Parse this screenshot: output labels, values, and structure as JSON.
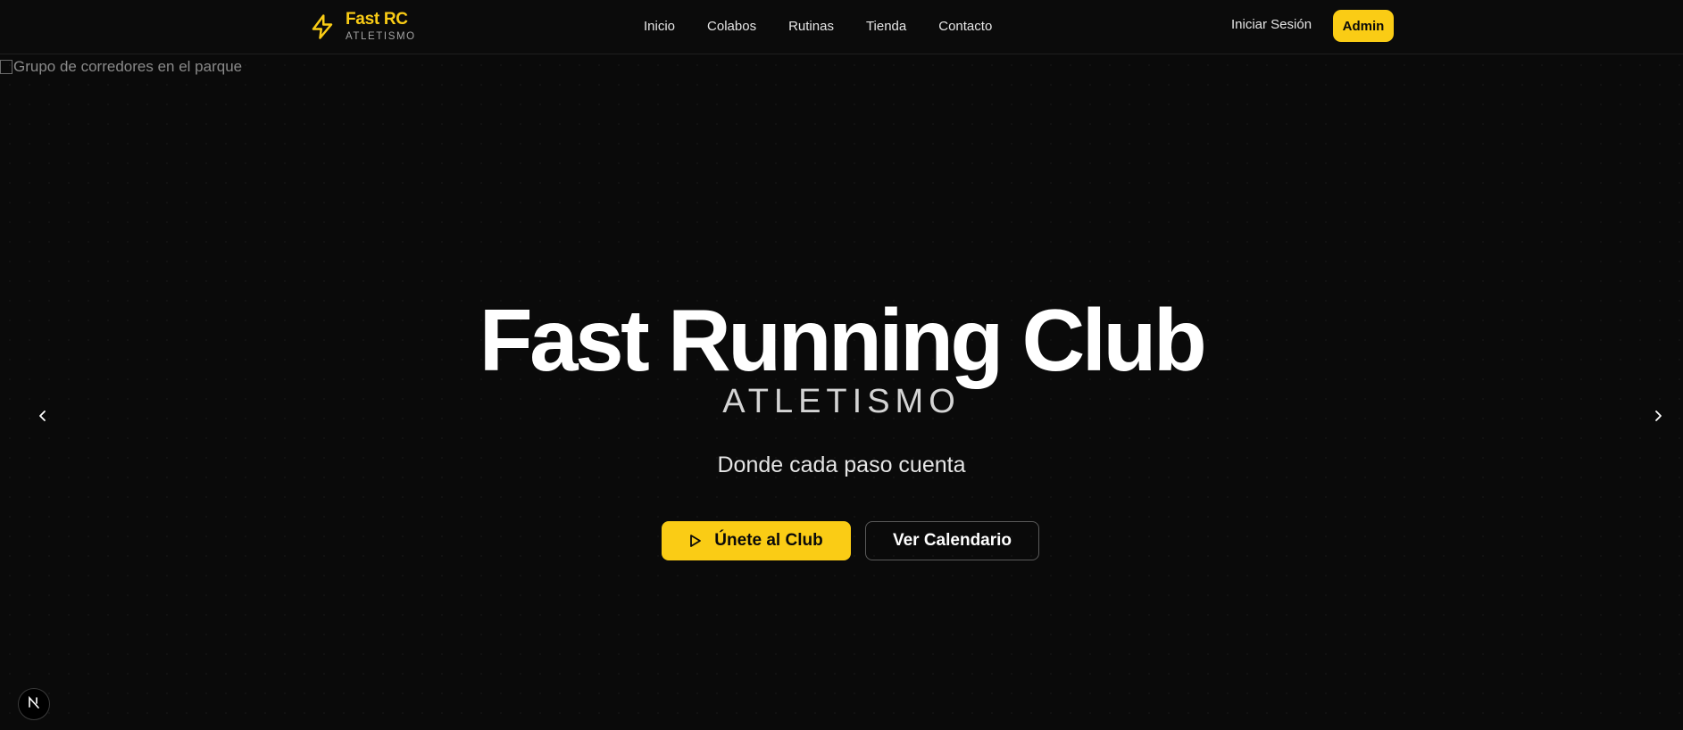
{
  "nav": {
    "brand_title": "Fast RC",
    "brand_subtitle": "ATLETISMO",
    "brand_icon": "lightning-bolt-icon",
    "links": [
      "Inicio",
      "Colabos",
      "Rutinas",
      "Tienda",
      "Contacto"
    ],
    "login_label": "Iniciar Sesión",
    "admin_label": "Admin"
  },
  "hero": {
    "image_alt": "Grupo de corredores en el parque",
    "title": "Fast Running Club",
    "subtitle": "ATLETISMO",
    "tagline": "Donde cada paso cuenta",
    "primary_cta": "Únete al Club",
    "primary_cta_icon": "play-icon",
    "secondary_cta": "Ver Calendario",
    "prev_icon": "chevron-left-icon",
    "next_icon": "chevron-right-icon"
  },
  "dev_badge": {
    "label": "N",
    "icon": "nextjs-logo-icon"
  },
  "colors": {
    "accent": "#facc15",
    "background": "#0a0a0a",
    "text": "#ffffff"
  }
}
